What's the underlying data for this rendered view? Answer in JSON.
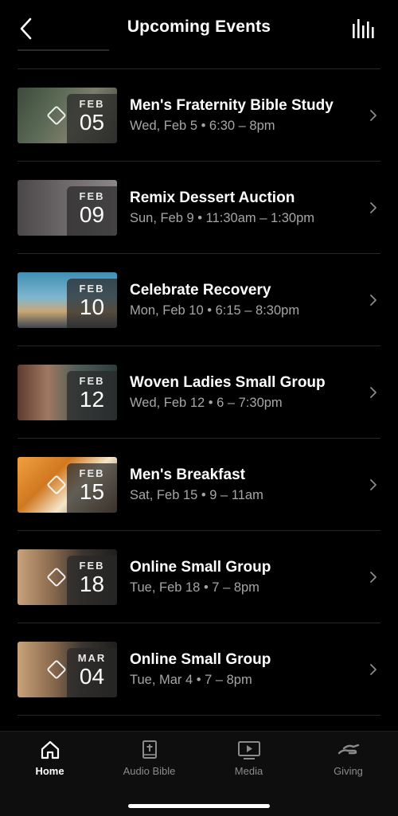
{
  "header": {
    "title": "Upcoming Events"
  },
  "events": [
    {
      "month": "FEB",
      "day": "05",
      "title": "Men's Fraternity Bible Study",
      "subtitle": "Wed, Feb 5 • 6:30 – 8pm"
    },
    {
      "month": "FEB",
      "day": "09",
      "title": "Remix Dessert Auction",
      "subtitle": "Sun, Feb 9 • 11:30am – 1:30pm"
    },
    {
      "month": "FEB",
      "day": "10",
      "title": "Celebrate Recovery",
      "subtitle": "Mon, Feb 10 • 6:15 – 8:30pm"
    },
    {
      "month": "FEB",
      "day": "12",
      "title": "Woven Ladies Small Group",
      "subtitle": "Wed, Feb 12 • 6 – 7:30pm"
    },
    {
      "month": "FEB",
      "day": "15",
      "title": "Men's Breakfast",
      "subtitle": "Sat, Feb 15 • 9 – 11am"
    },
    {
      "month": "FEB",
      "day": "18",
      "title": "Online Small Group",
      "subtitle": "Tue, Feb 18 • 7 – 8pm"
    },
    {
      "month": "MAR",
      "day": "04",
      "title": "Online Small Group",
      "subtitle": "Tue, Mar 4 • 7 – 8pm"
    }
  ],
  "tabs": [
    {
      "label": "Home",
      "icon": "home-icon",
      "active": true
    },
    {
      "label": "Audio Bible",
      "icon": "bible-icon",
      "active": false
    },
    {
      "label": "Media",
      "icon": "play-screen-icon",
      "active": false
    },
    {
      "label": "Giving",
      "icon": "giving-hand-icon",
      "active": false
    }
  ],
  "colors": {
    "background": "#000000",
    "text": "#ffffff",
    "subtext": "#a6a6a6",
    "tab_inactive": "#8b8b8b"
  }
}
